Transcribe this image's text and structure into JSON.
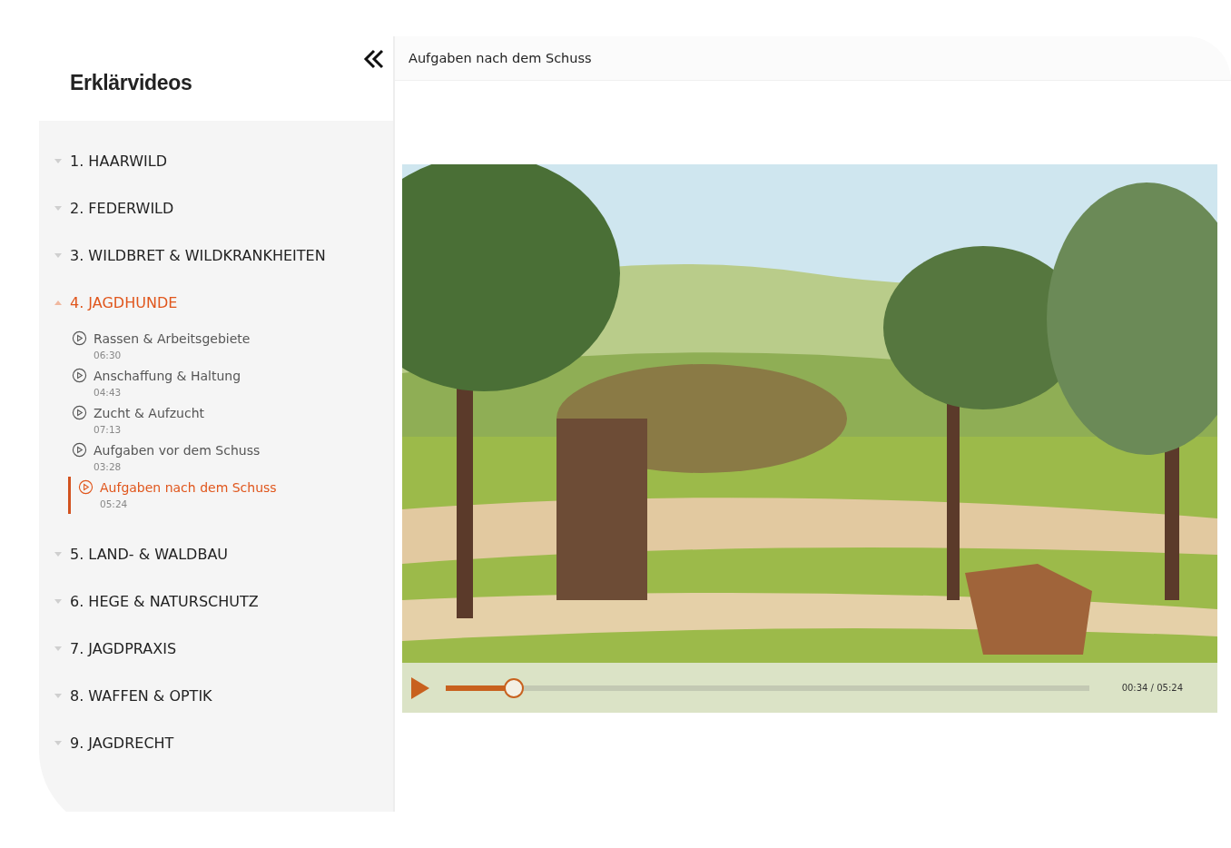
{
  "sidebar": {
    "title": "Erklärvideos",
    "sections": [
      {
        "label": "1. HAARWILD",
        "expanded": false
      },
      {
        "label": "2. FEDERWILD",
        "expanded": false
      },
      {
        "label": "3. WILDBRET & WILDKRANKHEITEN",
        "expanded": false
      },
      {
        "label": "4. JAGDHUNDE",
        "expanded": true,
        "children": [
          {
            "title": "Rassen & Arbeitsgebiete",
            "duration": "06:30",
            "selected": false
          },
          {
            "title": "Anschaffung & Haltung",
            "duration": "04:43",
            "selected": false
          },
          {
            "title": "Zucht & Aufzucht",
            "duration": "07:13",
            "selected": false
          },
          {
            "title": "Aufgaben vor dem Schuss",
            "duration": "03:28",
            "selected": false
          },
          {
            "title": "Aufgaben nach dem Schuss",
            "duration": "05:24",
            "selected": true
          }
        ]
      },
      {
        "label": "5. LAND- & WALDBAU",
        "expanded": false
      },
      {
        "label": "6. HEGE & NATURSCHUTZ",
        "expanded": false
      },
      {
        "label": "7. JAGDPRAXIS",
        "expanded": false
      },
      {
        "label": "8. WAFFEN & OPTIK",
        "expanded": false
      },
      {
        "label": "9. JAGDRECHT",
        "expanded": false
      }
    ]
  },
  "main": {
    "title": "Aufgaben nach dem Schuss"
  },
  "player": {
    "level": 0.105,
    "time": "00:34 / 05:24"
  }
}
